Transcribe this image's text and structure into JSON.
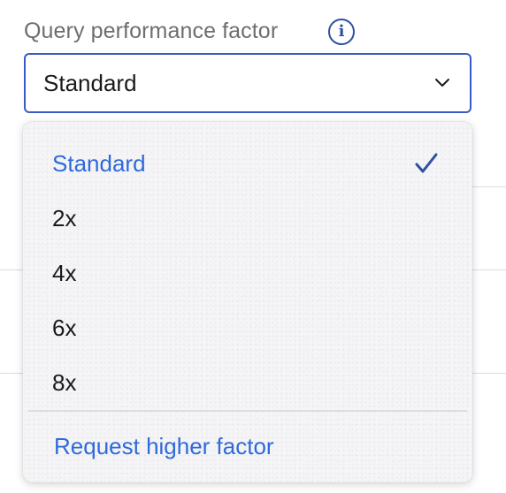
{
  "field": {
    "label": "Query performance factor",
    "info_icon": "info-icon",
    "selected_value": "Standard",
    "chevron_icon": "chevron-down-icon"
  },
  "dropdown": {
    "options": [
      {
        "label": "Standard",
        "selected": true
      },
      {
        "label": "2x",
        "selected": false
      },
      {
        "label": "4x",
        "selected": false
      },
      {
        "label": "6x",
        "selected": false
      },
      {
        "label": "8x",
        "selected": false
      }
    ],
    "check_icon": "checkmark-icon",
    "footer_link": "Request higher factor"
  },
  "colors": {
    "accent": "#2f6ad9",
    "border_focus": "#3a5bc7",
    "label_gray": "#6e6e6e",
    "menu_bg": "#f5f5f7",
    "text": "#1a1a1a"
  }
}
